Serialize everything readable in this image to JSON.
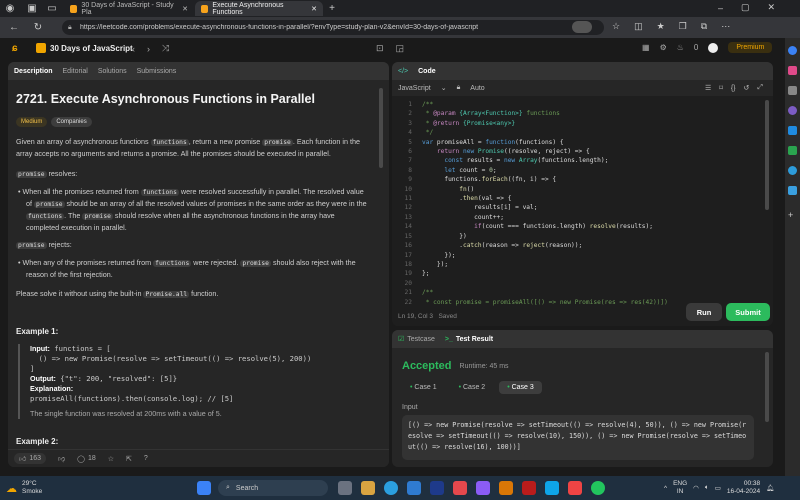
{
  "browser": {
    "tabs": [
      {
        "title": "30 Days of JavaScript - Study Pla"
      },
      {
        "title": "Execute Asynchronous Functions"
      }
    ],
    "url": "https://leetcode.com/problems/execute-asynchronous-functions-in-parallel/?envType=study-plan-v2&envId=30-days-of-javascript"
  },
  "header": {
    "study_plan": "30 Days of JavaScript",
    "streak": "0",
    "premium": "Premium"
  },
  "left": {
    "tabs": [
      "Description",
      "Editorial",
      "Solutions",
      "Submissions"
    ],
    "title": "2721. Execute Asynchronous Functions in Parallel",
    "difficulty": "Medium",
    "companies": "Companies",
    "p1a": "Given an array of asynchronous functions ",
    "p1b": "functions",
    "p1c": ", return a new promise ",
    "p1d": "promise",
    "p1e": ". Each function in the array accepts no arguments and returns a promise. All the promises should be executed in parallel.",
    "promise_kw": "promise",
    "resolves": " resolves:",
    "rejects": " rejects:",
    "b1a": "When all the promises returned from ",
    "b1b": "functions",
    "b1c": " were resolved successfully in parallel. The resolved value of ",
    "b1d": "promise",
    "b1e": " should be an array of all the resolved values of promises in the same order as they were in the ",
    "b1f": "functions",
    "b1g": ". The ",
    "b1h": "promise",
    "b1i": " should resolve when all the asynchronous functions in the array have completed execution in parallel.",
    "b2a": "When any of the promises returned from ",
    "b2b": "functions",
    "b2c": " were rejected. ",
    "b2d": "promise",
    "b2e": " should also reject with the reason of the first rejection.",
    "p3a": "Please solve it without using the built-in ",
    "p3b": "Promise.all",
    "p3c": " function.",
    "ex1_head": "Example 1:",
    "ex1_input_label": "Input:",
    "ex1_input_1": "functions = [",
    "ex1_input_2": "  () => new Promise(resolve => setTimeout(() => resolve(5), 200))",
    "ex1_input_3": "]",
    "ex1_output_label": "Output:",
    "ex1_output": "{\"t\": 200, \"resolved\": [5]}",
    "ex1_expl_label": "Explanation:",
    "ex1_expl_1": "promiseAll(functions).then(console.log); // [5]",
    "ex1_expl_2": "The single function was resolved at 200ms with a value of 5.",
    "ex2_head": "Example 2:",
    "likes": "163",
    "comments": "18"
  },
  "code": {
    "title": "Code",
    "language": "JavaScript",
    "mode": "Auto",
    "lines": [
      "/**",
      " * @param {Array<Function>} functions",
      " * @return {Promise<any>}",
      " */",
      "var promiseAll = function(functions) {",
      "    return new Promise((resolve, reject) => {",
      "      const results = new Array(functions.length);",
      "      let count = 0;",
      "      functions.forEach((fn, i) => {",
      "          fn()",
      "          .then(val => {",
      "              results[i] = val;",
      "              count++;",
      "              if(count === functions.length) resolve(results);",
      "          })",
      "          .catch(reason => reject(reason));",
      "      });",
      "    });",
      "};",
      "",
      "/**",
      " * const promise = promiseAll([() => new Promise(res => res(42))])"
    ],
    "status": "Ln 19, Col 3   Saved",
    "run": "Run",
    "submit": "Submit"
  },
  "result": {
    "tabs": [
      "Testcase",
      "Test Result"
    ],
    "status": "Accepted",
    "runtime": "Runtime: 45 ms",
    "cases": [
      "Case 1",
      "Case 2",
      "Case 3"
    ],
    "input_label": "Input",
    "input": "[() => new Promise(resolve => setTimeout(() => resolve(4), 50)), () => new Promise(resolve => setTimeout(() => resolve(10), 150)), () => new Promise(resolve => setTimeout(() => resolve(16), 100))]"
  },
  "taskbar": {
    "temp": "29°C",
    "weather": "Smoke",
    "search": "Search",
    "lang1": "ENG",
    "lang2": "IN",
    "time": "00:38",
    "date": "16-04-2024"
  }
}
